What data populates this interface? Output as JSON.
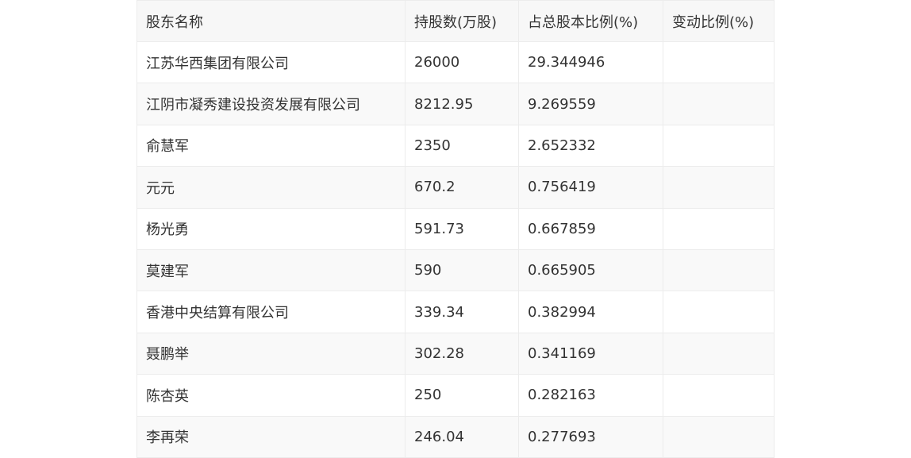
{
  "table": {
    "headers": [
      "股东名称",
      "持股数(万股)",
      "占总股本比例(%)",
      "变动比例(%)"
    ],
    "rows": [
      [
        "江苏华西集团有限公司",
        "26000",
        "29.344946",
        ""
      ],
      [
        "江阴市凝秀建设投资发展有限公司",
        "8212.95",
        "9.269559",
        ""
      ],
      [
        "俞慧军",
        "2350",
        "2.652332",
        ""
      ],
      [
        "元元",
        "670.2",
        "0.756419",
        ""
      ],
      [
        "杨光勇",
        "591.73",
        "0.667859",
        ""
      ],
      [
        "莫建军",
        "590",
        "0.665905",
        ""
      ],
      [
        "香港中央结算有限公司",
        "339.34",
        "0.382994",
        ""
      ],
      [
        "聂鹏举",
        "302.28",
        "0.341169",
        ""
      ],
      [
        "陈杏英",
        "250",
        "0.282163",
        ""
      ],
      [
        "李再荣",
        "246.04",
        "0.277693",
        ""
      ]
    ]
  }
}
